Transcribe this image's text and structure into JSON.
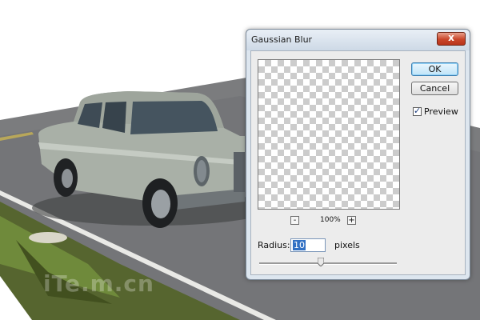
{
  "dialog": {
    "title": "Gaussian Blur",
    "close_glyph": "x",
    "ok_label": "OK",
    "cancel_label": "Cancel",
    "preview_label": "Preview",
    "preview_checked": true,
    "zoom_level": "100%",
    "zoom_out_glyph": "-",
    "zoom_in_glyph": "+",
    "radius_label": "Radius:",
    "radius_value": "10",
    "units_label": "pixels",
    "slider_fraction": 0.45
  },
  "watermark": "iTe.m.cn",
  "icons": {
    "close": "close-icon",
    "checkbox": "checkmark-icon",
    "slider": "slider-thumb-icon"
  },
  "colors": {
    "accent": "#3271c4",
    "close_button": "#c9462a",
    "dialog_frame": "#dde6ef",
    "road": "#7b7c7e",
    "car_body": "#a9b0a7"
  }
}
